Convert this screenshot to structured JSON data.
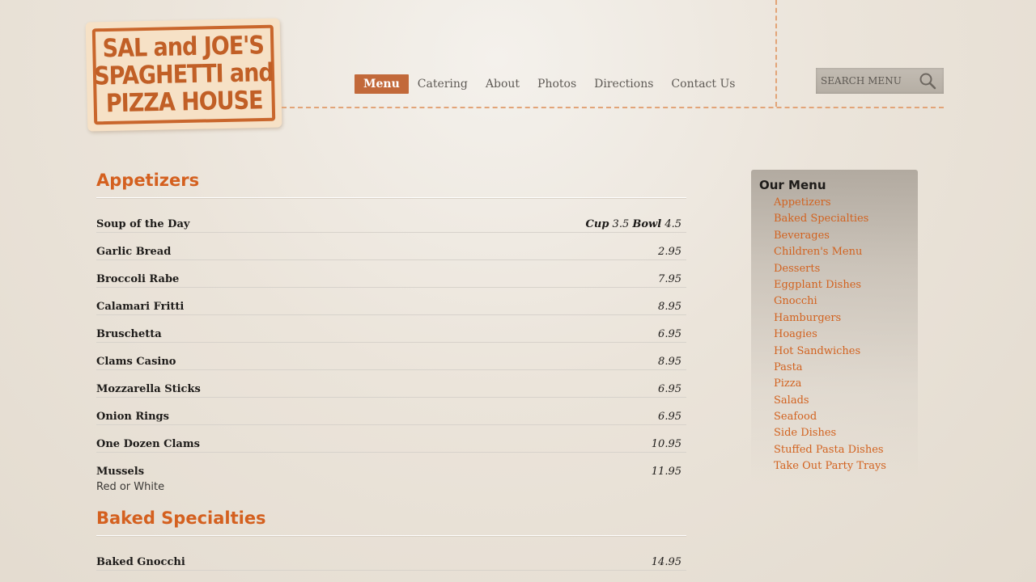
{
  "logo": {
    "line1": "SAL and JOE'S",
    "line2": "SPAGHETTI and",
    "line3": "PIZZA HOUSE"
  },
  "nav": {
    "items": [
      {
        "label": "Menu",
        "active": true
      },
      {
        "label": "Catering",
        "active": false
      },
      {
        "label": "About",
        "active": false
      },
      {
        "label": "Photos",
        "active": false
      },
      {
        "label": "Directions",
        "active": false
      },
      {
        "label": "Contact Us",
        "active": false
      }
    ]
  },
  "search": {
    "placeholder": "SEARCH MENU",
    "icon": "search-icon"
  },
  "sections": [
    {
      "title": "Appetizers",
      "items": [
        {
          "name": "Soup of the Day",
          "price_cup_label": "Cup",
          "price_cup": "3.5",
          "price_bowl_label": "Bowl",
          "price_bowl": "4.5"
        },
        {
          "name": "Garlic Bread",
          "price": "2.95"
        },
        {
          "name": "Broccoli Rabe",
          "price": "7.95"
        },
        {
          "name": "Calamari Fritti",
          "price": "8.95"
        },
        {
          "name": "Bruschetta",
          "price": "6.95"
        },
        {
          "name": "Clams Casino",
          "price": "8.95"
        },
        {
          "name": "Mozzarella Sticks",
          "price": "6.95"
        },
        {
          "name": "Onion Rings",
          "price": "6.95"
        },
        {
          "name": "One Dozen Clams",
          "price": "10.95"
        },
        {
          "name": "Mussels",
          "price": "11.95",
          "note": "Red or White"
        }
      ]
    },
    {
      "title": "Baked Specialties",
      "items": [
        {
          "name": "Baked Gnocchi",
          "price": "14.95"
        }
      ]
    }
  ],
  "sidebar": {
    "title": "Our Menu",
    "items": [
      "Appetizers",
      "Baked Specialties",
      "Beverages",
      "Children's Menu",
      "Desserts",
      "Eggplant Dishes",
      "Gnocchi",
      "Hamburgers",
      "Hoagies",
      "Hot Sandwiches",
      "Pasta",
      "Pizza",
      "Salads",
      "Seafood",
      "Side Dishes",
      "Stuffed Pasta Dishes",
      "Take Out Party Trays"
    ]
  },
  "colors": {
    "accent": "#d4601f",
    "nav_active": "#c2693a",
    "dash": "#e2a478"
  }
}
